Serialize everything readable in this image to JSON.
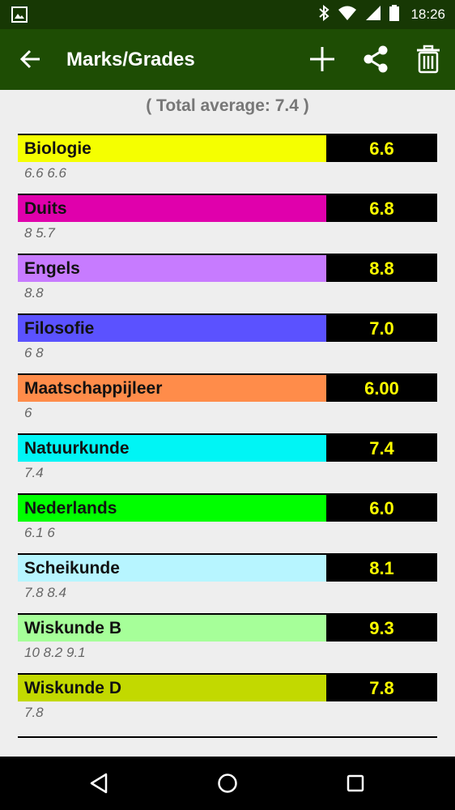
{
  "status": {
    "time": "18:26"
  },
  "appbar": {
    "title": "Marks/Grades"
  },
  "summary": {
    "total_average": "( Total average:  7.4 )"
  },
  "subjects": [
    {
      "name": "Biologie",
      "average": "6.6",
      "marks": "6.6 6.6",
      "color": "#f5ff00"
    },
    {
      "name": "Duits",
      "average": "6.8",
      "marks": "8 5.7",
      "color": "#e000ac"
    },
    {
      "name": "Engels",
      "average": "8.8",
      "marks": "8.8",
      "color": "#c77bff"
    },
    {
      "name": "Filosofie",
      "average": "7.0",
      "marks": "6 8",
      "color": "#5b52ff"
    },
    {
      "name": "Maatschappijleer",
      "average": "6.00",
      "marks": "6",
      "color": "#ff8c4a"
    },
    {
      "name": "Natuurkunde",
      "average": "7.4",
      "marks": "7.4",
      "color": "#00f5f5"
    },
    {
      "name": "Nederlands",
      "average": "6.0",
      "marks": "6.1 6",
      "color": "#00ff00"
    },
    {
      "name": "Scheikunde",
      "average": "8.1",
      "marks": "7.8 8.4",
      "color": "#b7f5ff"
    },
    {
      "name": "Wiskunde B",
      "average": "9.3",
      "marks": "10 8.2 9.1",
      "color": "#a6ff99"
    },
    {
      "name": "Wiskunde D",
      "average": "7.8",
      "marks": "7.8",
      "color": "#c2d900"
    }
  ],
  "colors": {
    "status_bar": "#173804",
    "app_bar": "#1e4d04",
    "average_text": "#ffff00"
  },
  "icons": {
    "back": "arrow-left-icon",
    "add": "plus-icon",
    "share": "share-icon",
    "delete": "trash-icon"
  }
}
